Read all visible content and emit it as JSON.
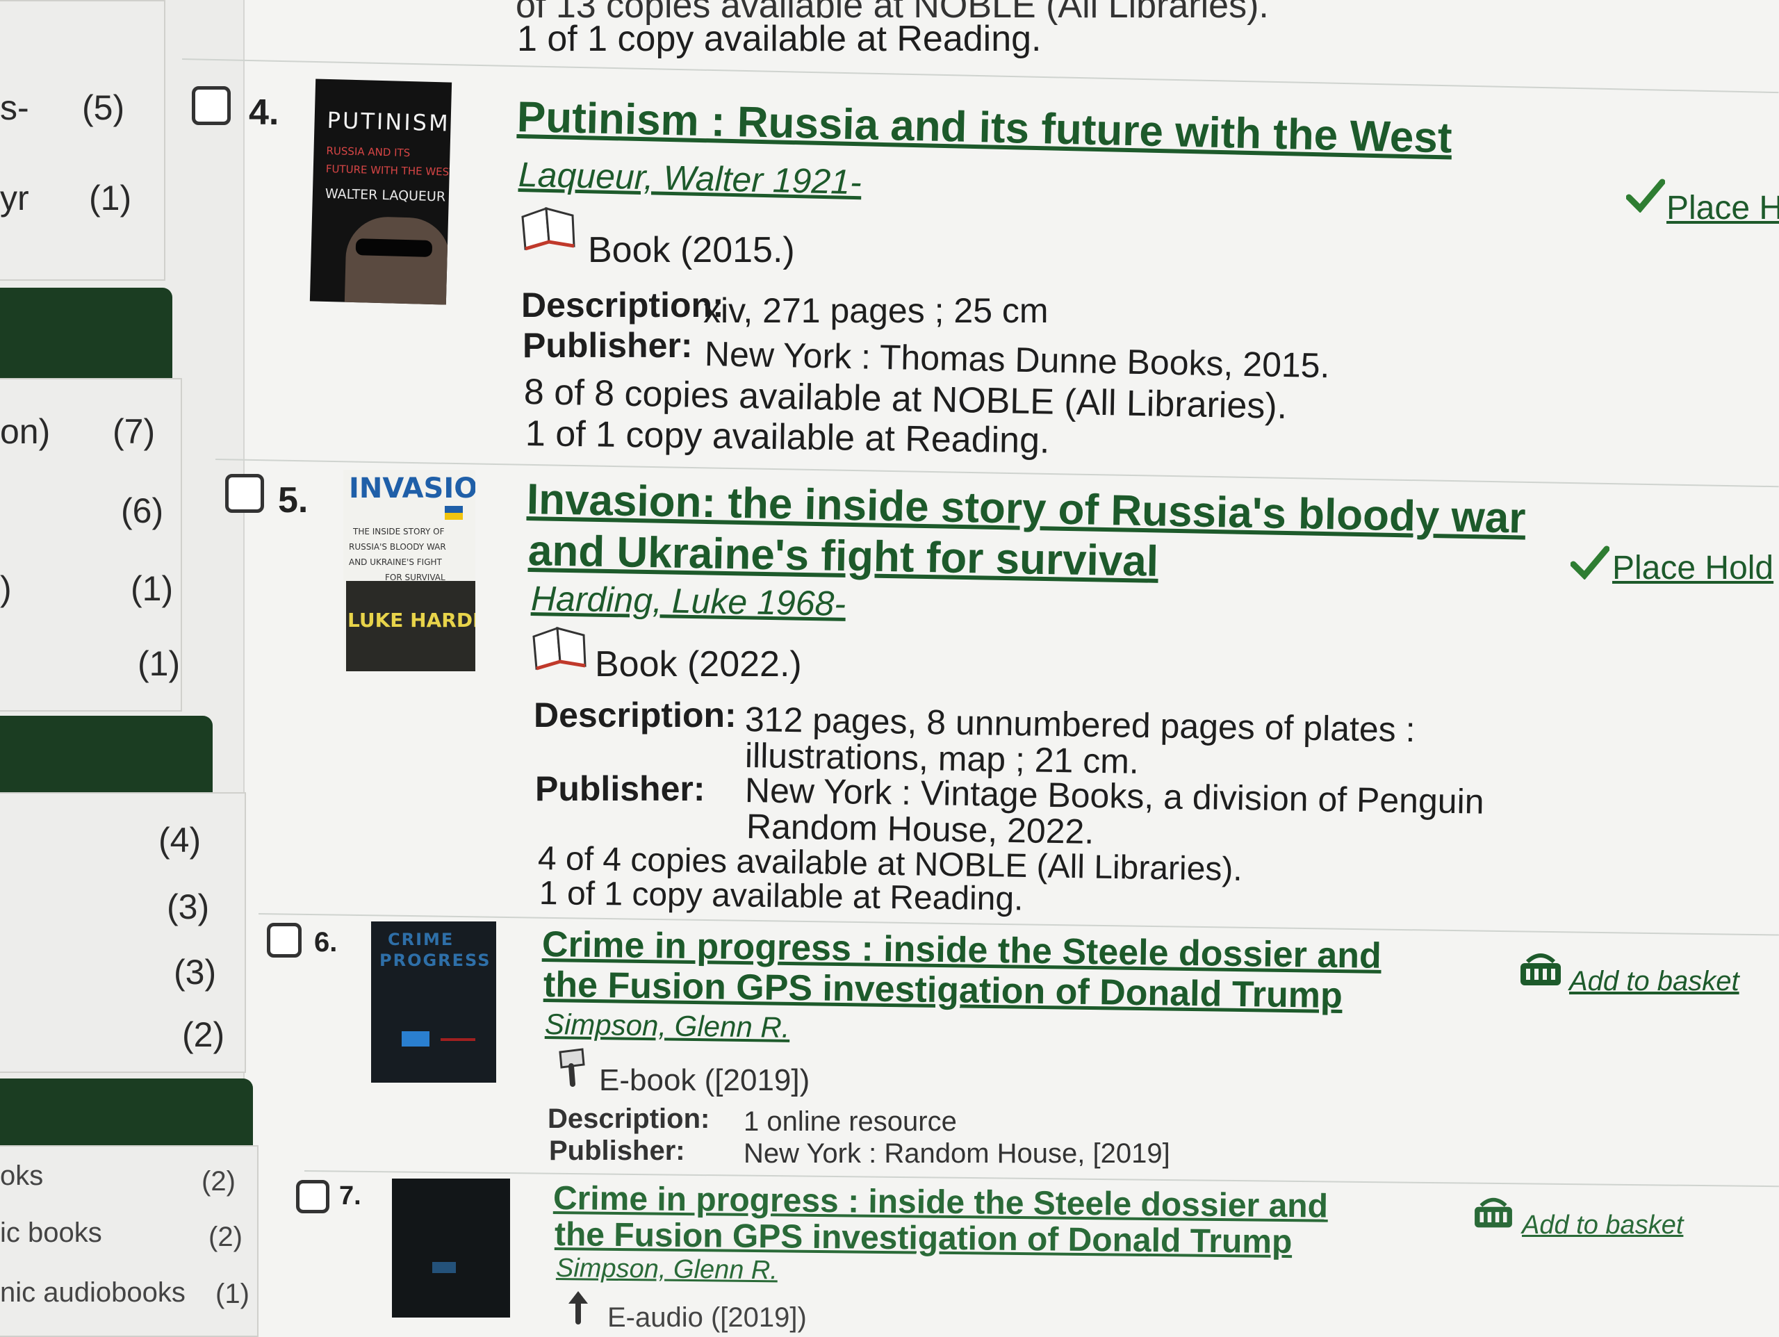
{
  "top": {
    "partial_line": "of 13 copies available at NOBLE (All Libraries).",
    "reading_line": "1 of 1 copy available at Reading."
  },
  "sidebar": {
    "group1": [
      {
        "label": "s-",
        "count": "(5)"
      },
      {
        "label": "yr",
        "count": "(1)"
      }
    ],
    "group2": [
      {
        "label": "on)",
        "count": "(7)"
      },
      {
        "label": "",
        "count": "(6)"
      },
      {
        "label": ")",
        "count": "(1)"
      },
      {
        "label": "",
        "count": "(1)"
      }
    ],
    "group3": [
      {
        "label": "",
        "count": "(4)"
      },
      {
        "label": "",
        "count": "(3)"
      },
      {
        "label": "",
        "count": "(3)"
      },
      {
        "label": "",
        "count": "(2)"
      }
    ],
    "group4": [
      {
        "label": "oks",
        "count": "(2)"
      },
      {
        "label": "ic books",
        "count": "(2)"
      },
      {
        "label": "nic audiobooks",
        "count": "(1)"
      }
    ]
  },
  "labels": {
    "description": "Description:",
    "publisher": "Publisher:"
  },
  "results": [
    {
      "number": "4.",
      "cover": {
        "title": "PUTINISM",
        "subtitle1": "RUSSIA AND ITS",
        "subtitle2": "FUTURE WITH THE WEST",
        "author": "WALTER LAQUEUR"
      },
      "title": "Putinism : Russia and its future with the West",
      "author": "Laqueur, Walter 1921-",
      "format": "Book (2015.)",
      "description": "xiv, 271 pages ; 25 cm",
      "publisher": "New York : Thomas Dunne Books, 2015.",
      "availability_noble": "8 of 8 copies available at NOBLE (All Libraries).",
      "availability_reading": "1 of 1 copy available at Reading.",
      "action": "Place H"
    },
    {
      "number": "5.",
      "cover": {
        "title": "INVASION",
        "sub1": "THE INSIDE STORY OF",
        "sub2": "RUSSIA'S BLOODY WAR",
        "sub3": "AND UKRAINE'S FIGHT",
        "sub4": "FOR SURVIVAL",
        "author": "LUKE HARDING"
      },
      "title_line1": "Invasion: the inside story of Russia's bloody war",
      "title_line2": "and Ukraine's fight for survival",
      "author": "Harding, Luke 1968-",
      "format": "Book (2022.)",
      "description_line1": "312 pages, 8 unnumbered pages of plates :",
      "description_line2": "illustrations, map ; 21 cm.",
      "publisher_line1": "New York : Vintage Books, a division of Penguin",
      "publisher_line2": "Random House, 2022.",
      "availability_noble": "4 of 4 copies available at NOBLE (All Libraries).",
      "availability_reading": "1 of 1 copy available at Reading.",
      "action": "Place Hold"
    },
    {
      "number": "6.",
      "cover": {
        "title1": "CRIME",
        "title2": "PROGRESS"
      },
      "title_line1": "Crime in progress : inside the Steele dossier and",
      "title_line2": "the Fusion GPS investigation of Donald Trump",
      "author": "Simpson, Glenn R.",
      "format": "E-book ([2019])",
      "description": "1 online resource",
      "publisher": "New York : Random House, [2019]",
      "action": "Add to basket"
    },
    {
      "number": "7.",
      "title_line1": "Crime in progress : inside the Steele dossier and",
      "title_line2": "the Fusion GPS investigation of Donald Trump",
      "author": "Simpson, Glenn R.",
      "format": "E-audio ([2019])",
      "action": "Add to basket"
    }
  ],
  "colors": {
    "link": "#1d5a2b",
    "facet_header": "#1b3d22",
    "check": "#2e7d32"
  }
}
